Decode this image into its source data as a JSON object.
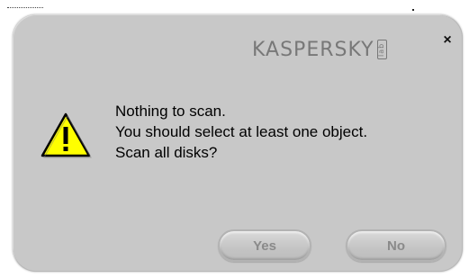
{
  "dialog": {
    "brand_logo": "KASPERSKY",
    "brand_suffix": "lab",
    "close_glyph": "×",
    "icon": "warning-icon",
    "message_lines": [
      "Nothing to scan.",
      "You should select at least one object.",
      "Scan all disks?"
    ],
    "buttons": {
      "yes_label": "Yes",
      "no_label": "No"
    }
  },
  "colors": {
    "dialog_background": "#c8c8c8",
    "warning_fill": "#ffff00",
    "button_text": "#8a8a8a"
  }
}
